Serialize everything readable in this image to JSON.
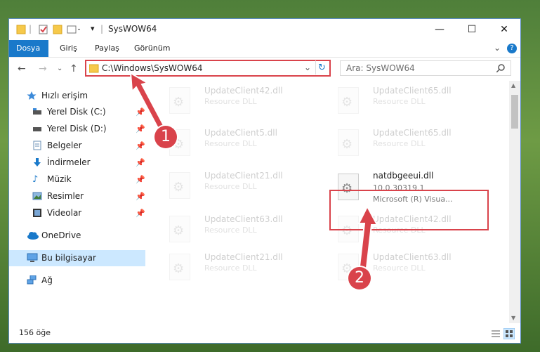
{
  "window": {
    "title": "SysWOW64",
    "minimize": "—",
    "maximize": "☐",
    "close": "✕"
  },
  "ribbon": {
    "tabs": [
      "Dosya",
      "Giriş",
      "Paylaş",
      "Görünüm"
    ],
    "expand": "⌄",
    "help": "?"
  },
  "address": {
    "path": "C:\\Windows\\SysWOW64"
  },
  "search": {
    "placeholder": "Ara: SysWOW64"
  },
  "nav": {
    "quick_access": "Hızlı erişim",
    "items": [
      "Yerel Disk (C:)",
      "Yerel Disk (D:)",
      "Belgeler",
      "İndirmeler",
      "Müzik",
      "Resimler",
      "Videolar"
    ],
    "onedrive": "OneDrive",
    "this_pc": "Bu bilgisayar",
    "network": "Ağ"
  },
  "files": [
    {
      "name": "UpdateClient42.dll",
      "subtitle": "Resource DLL"
    },
    {
      "name": "UpdateClient65.dll",
      "subtitle": "Resource DLL"
    },
    {
      "name": "UpdateClient5.dll",
      "subtitle": "Resource DLL"
    },
    {
      "name": "UpdateClient65.dll",
      "subtitle": "Resource DLL"
    },
    {
      "name": "UpdateClient21.dll",
      "subtitle": "Resource DLL"
    },
    {
      "name": "natdbgeeui.dll",
      "subtitle": "10.0.30319.1",
      "subtitle2": "Microsoft (R) Visua..."
    },
    {
      "name": "UpdateClient63.dll",
      "subtitle": "Resource DLL"
    },
    {
      "name": "UpdateClient42.dll",
      "subtitle": "Resource DLL"
    },
    {
      "name": "UpdateClient21.dll",
      "subtitle": "Resource DLL"
    },
    {
      "name": "UpdateClient63.dll",
      "subtitle": "Resource DLL"
    }
  ],
  "status": {
    "count": "156 öğe"
  },
  "annotations": {
    "step1": "1",
    "step2": "2"
  },
  "colors": {
    "accent": "#1979ca",
    "highlight": "#d9434b",
    "selection": "#cce8ff"
  }
}
